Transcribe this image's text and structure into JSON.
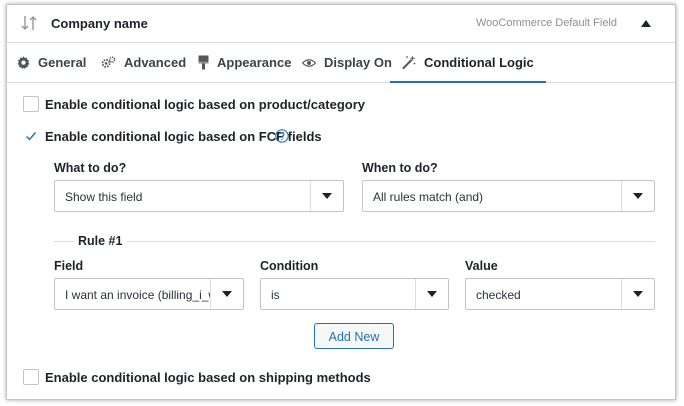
{
  "header": {
    "title": "Company name",
    "field_type": "WooCommerce Default Field"
  },
  "tabs": [
    {
      "label": "General",
      "icon": "gear-icon"
    },
    {
      "label": "Advanced",
      "icon": "gears-icon"
    },
    {
      "label": "Appearance",
      "icon": "paint-brush-icon"
    },
    {
      "label": "Display On",
      "icon": "eye-icon"
    },
    {
      "label": "Conditional Logic",
      "icon": "magic-wand-icon",
      "active": true
    }
  ],
  "options": {
    "product_category": {
      "label": "Enable conditional logic based on product/category",
      "checked": false
    },
    "fcf_fields": {
      "label": "Enable conditional logic based on FCF fields",
      "checked": true
    },
    "shipping_methods": {
      "label": "Enable conditional logic based on shipping methods",
      "checked": false
    }
  },
  "logic": {
    "what_label": "What to do?",
    "what_value": "Show this field",
    "when_label": "When to do?",
    "when_value": "All rules match (and)"
  },
  "rule": {
    "title": "Rule #1",
    "field_label": "Field",
    "field_value": "I want an invoice (billing_i_w...",
    "condition_label": "Condition",
    "condition_value": "is",
    "value_label": "Value",
    "value_value": "checked"
  },
  "add_new_label": "Add New",
  "colors": {
    "accent": "#2271b1",
    "border": "#c3c4c7"
  }
}
